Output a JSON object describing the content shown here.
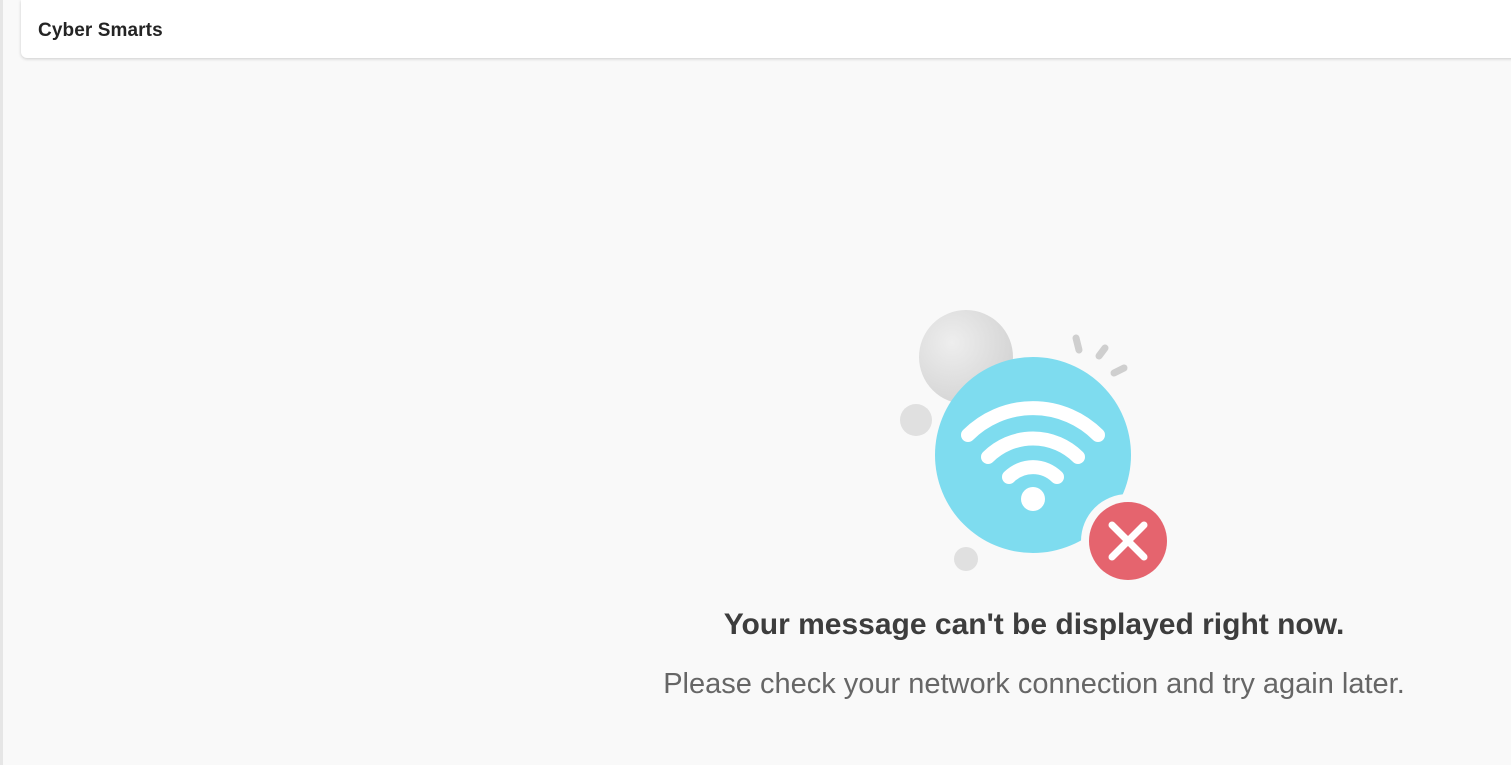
{
  "header": {
    "title": "Cyber Smarts"
  },
  "error": {
    "title": "Your message can't be displayed right now.",
    "subtitle": "Please check your network connection and try again later."
  },
  "illustration": {
    "icons": [
      "wifi-icon",
      "error-x-icon"
    ],
    "colors": {
      "wifi_circle": "#7edcef",
      "error_badge": "#e5646e",
      "decor_gray": "#dcdcdc"
    }
  }
}
